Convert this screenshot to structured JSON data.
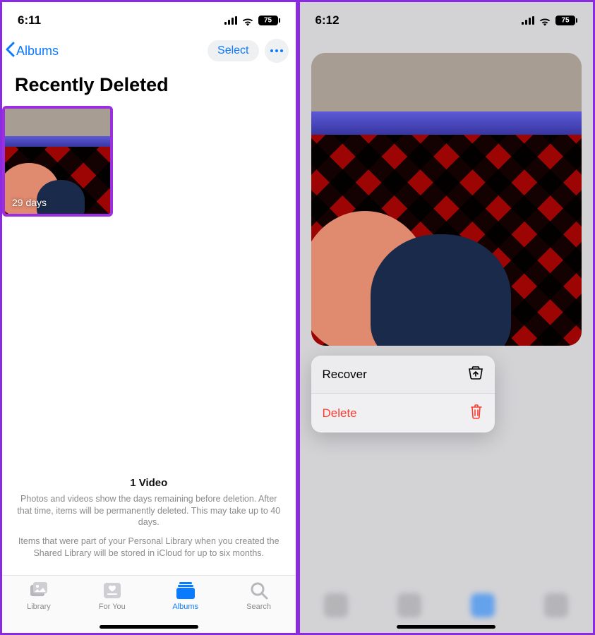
{
  "left": {
    "status": {
      "time": "6:11",
      "battery": "75"
    },
    "nav": {
      "back_label": "Albums",
      "select_label": "Select"
    },
    "title": "Recently Deleted",
    "thumb": {
      "days_label": "29 days"
    },
    "info": {
      "count_title": "1 Video",
      "line1": "Photos and videos show the days remaining before deletion. After that time, items will be permanently deleted. This may take up to 40 days.",
      "line2": "Items that were part of your Personal Library when you created the Shared Library will be stored in iCloud for up to six months."
    },
    "tabs": {
      "library": "Library",
      "foryou": "For You",
      "albums": "Albums",
      "search": "Search"
    }
  },
  "right": {
    "status": {
      "time": "6:12",
      "battery": "75"
    },
    "menu": {
      "recover": "Recover",
      "delete": "Delete"
    }
  }
}
